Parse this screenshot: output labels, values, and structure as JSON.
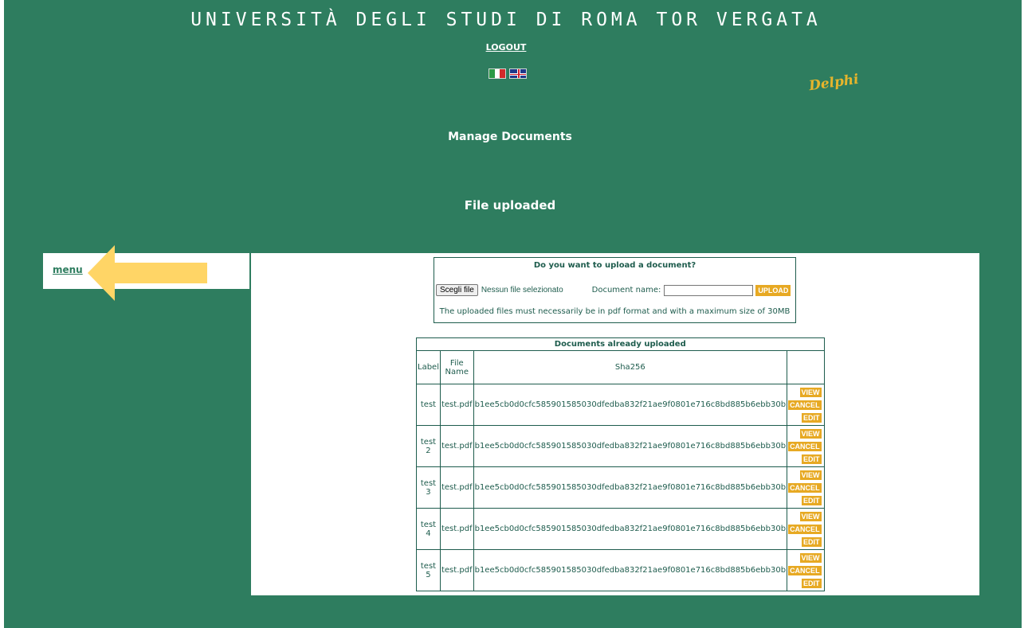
{
  "header": {
    "university": "UNIVERSITÀ DEGLI STUDI DI ROMA TOR VERGATA",
    "logout": "LOGOUT",
    "logo": "Delphi"
  },
  "titles": {
    "section": "Manage Documents",
    "status": "File uploaded"
  },
  "sidebar": {
    "menu_label": "menu"
  },
  "colors": {
    "background": "#2e7d5f",
    "accent": "#e7a923",
    "text": "#1e5c4d",
    "arrow": "#ffd566"
  },
  "upload": {
    "heading": "Do you want to upload a document?",
    "choose_button": "Scegli file",
    "no_file": "Nessun file selezionato",
    "doc_name_label": "Document name:",
    "doc_name_value": "",
    "upload_button": "UPLOAD",
    "note": "The uploaded files must necessarily be in pdf format and with a maximum size of 30MB"
  },
  "documents": {
    "caption": "Documents already uploaded",
    "columns": [
      "Label",
      "File Name",
      "Sha256",
      ""
    ],
    "actions": {
      "view": "VIEW",
      "cancel": "CANCEL",
      "edit": "EDIT"
    },
    "rows": [
      {
        "label": "test",
        "file": "test.pdf",
        "hash": "b1ee5cb0d0cfc585901585030dfedba832f21ae9f0801e716c8bd885b6ebb30b"
      },
      {
        "label": "test 2",
        "file": "test.pdf",
        "hash": "b1ee5cb0d0cfc585901585030dfedba832f21ae9f0801e716c8bd885b6ebb30b"
      },
      {
        "label": "test 3",
        "file": "test.pdf",
        "hash": "b1ee5cb0d0cfc585901585030dfedba832f21ae9f0801e716c8bd885b6ebb30b"
      },
      {
        "label": "test 4",
        "file": "test.pdf",
        "hash": "b1ee5cb0d0cfc585901585030dfedba832f21ae9f0801e716c8bd885b6ebb30b"
      },
      {
        "label": "test 5",
        "file": "test.pdf",
        "hash": "b1ee5cb0d0cfc585901585030dfedba832f21ae9f0801e716c8bd885b6ebb30b"
      }
    ]
  }
}
